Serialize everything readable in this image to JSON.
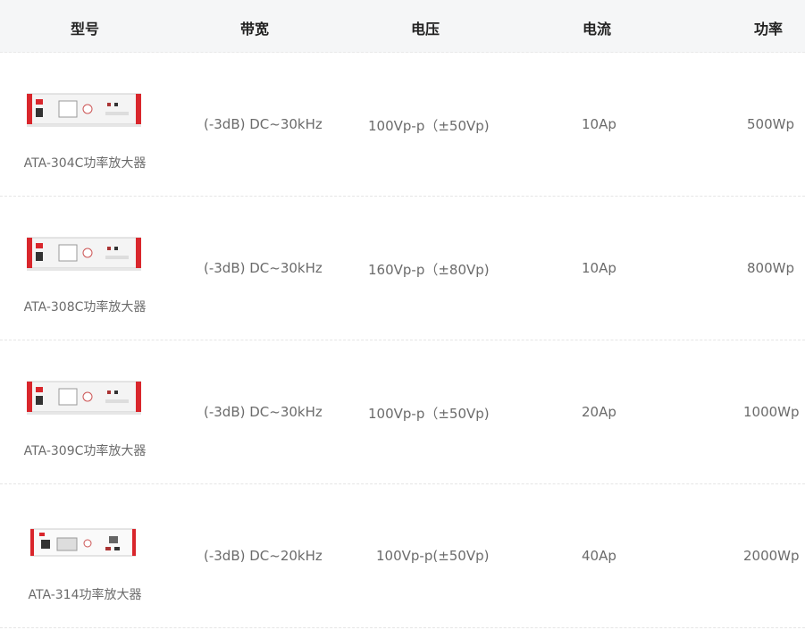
{
  "headers": {
    "model": "型号",
    "bandwidth": "带宽",
    "voltage": "电压",
    "current": "电流",
    "power": "功率"
  },
  "rows": [
    {
      "model": "ATA-304C功率放大器",
      "bandwidth": "(-3dB)  DC~30kHz",
      "voltage": "100Vp-p（±50Vp)",
      "current": "10Ap",
      "power": "500Wp"
    },
    {
      "model": "ATA-308C功率放大器",
      "bandwidth": "(-3dB)  DC~30kHz",
      "voltage": "160Vp-p（±80Vp)",
      "current": "10Ap",
      "power": "800Wp"
    },
    {
      "model": "ATA-309C功率放大器",
      "bandwidth": "(-3dB)  DC~30kHz",
      "voltage": "100Vp-p（±50Vp)",
      "current": "20Ap",
      "power": "1000Wp"
    },
    {
      "model": "ATA-314功率放大器",
      "bandwidth": "(-3dB)  DC~20kHz",
      "voltage": "100Vp-p(±50Vp)",
      "current": "40Ap",
      "power": "2000Wp"
    }
  ],
  "colors": {
    "header_bg": "#f5f6f7",
    "accent_red": "#d9262c",
    "text": "#6b6b6b"
  },
  "icons": [
    "amplifier-product-image"
  ]
}
